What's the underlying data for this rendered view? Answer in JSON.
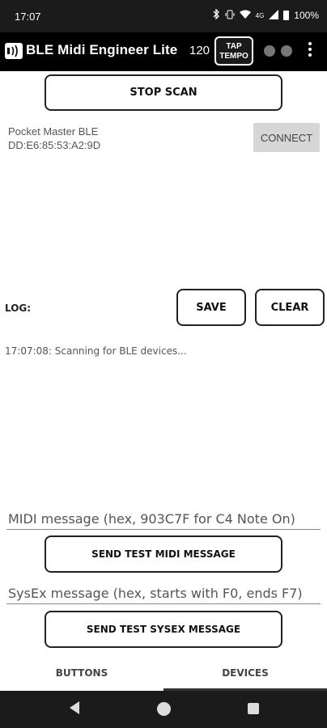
{
  "status_bar": {
    "time": "17:07",
    "battery": "100%",
    "network_label": "4G"
  },
  "app_bar": {
    "title": "BLE Midi Engineer Lite",
    "bpm": "120",
    "tap_line1": "TAP",
    "tap_line2": "TEMPO"
  },
  "scan": {
    "stop_label": "STOP SCAN"
  },
  "device": {
    "name": "Pocket Master BLE",
    "mac": "DD:E6:85:53:A2:9D",
    "connect_label": "CONNECT"
  },
  "log": {
    "label": "LOG:",
    "save_label": "SAVE",
    "clear_label": "CLEAR",
    "entries": [
      "17:07:08: Scanning for BLE devices..."
    ]
  },
  "midi": {
    "placeholder": "MIDI message (hex, 903C7F for C4 Note On)",
    "send_label": "SEND TEST MIDI MESSAGE"
  },
  "sysex": {
    "placeholder": "SysEx message (hex, starts with F0, ends F7)",
    "send_label": "SEND TEST SYSEX MESSAGE"
  },
  "tabs": {
    "buttons": "BUTTONS",
    "devices": "DEVICES",
    "active": "DEVICES"
  }
}
